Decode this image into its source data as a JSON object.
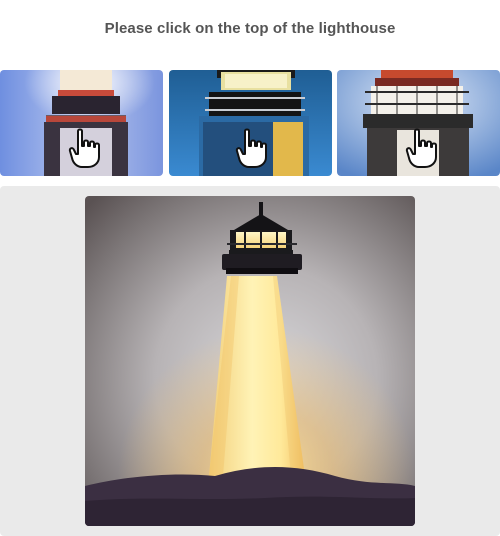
{
  "challenge": {
    "prompt": "Please click on the top of the lighthouse"
  },
  "examples": [
    {
      "icon": "hand-pointer-icon"
    },
    {
      "icon": "hand-pointer-icon"
    },
    {
      "icon": "hand-pointer-icon"
    }
  ],
  "colors": {
    "prompt_text": "#555555",
    "task_area_bg": "#eaeaea"
  }
}
